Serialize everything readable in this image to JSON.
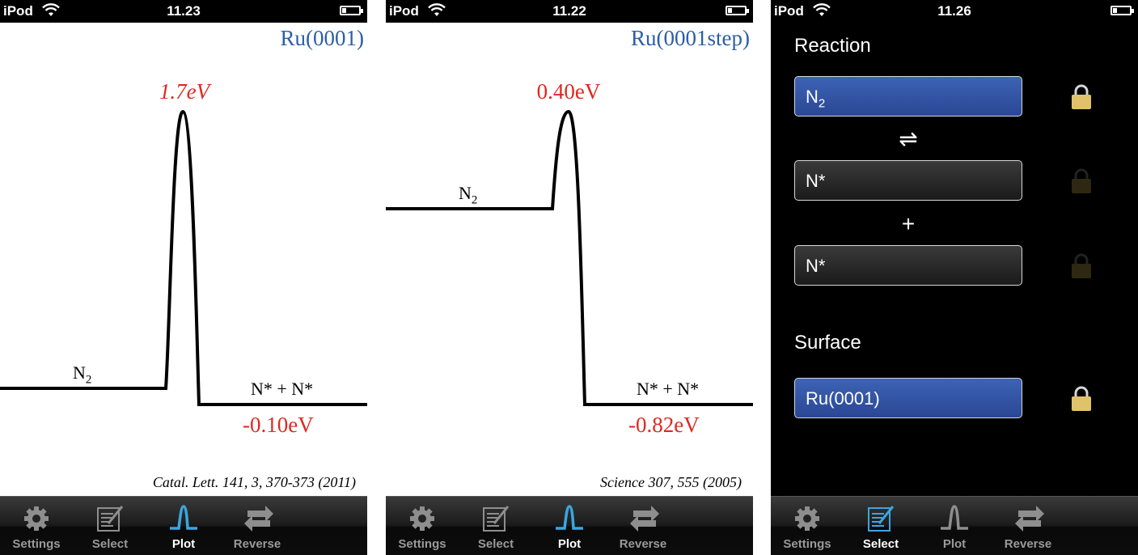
{
  "screens": [
    {
      "status": {
        "carrier": "iPod",
        "time": "11.23"
      },
      "plot": {
        "title": "Ru(0001)",
        "barrier_label": "1.7eV",
        "reactant_label": "N",
        "reactant_sub": "2",
        "product_label": "N* + N*",
        "reaction_energy": "-0.10eV",
        "reference": "Catal. Lett. 141, 3, 370-373 (2011)"
      }
    },
    {
      "status": {
        "carrier": "iPod",
        "time": "11.22"
      },
      "plot": {
        "title": "Ru(0001step)",
        "barrier_label": "0.40eV",
        "reactant_label": "N",
        "reactant_sub": "2",
        "product_label": "N* + N*",
        "reaction_energy": "-0.82eV",
        "reference": "Science 307, 555 (2005)"
      }
    },
    {
      "status": {
        "carrier": "iPod",
        "time": "11.26"
      },
      "reaction": {
        "heading": "Reaction",
        "reactant": "N",
        "reactant_sub": "2",
        "equilibrium_symbol": "⇌",
        "product1": "N*",
        "plus_symbol": "+",
        "product2": "N*"
      },
      "surface": {
        "heading": "Surface",
        "value": "Ru(0001)"
      }
    }
  ],
  "tabs": [
    "Settings",
    "Select",
    "Plot",
    "Reverse"
  ],
  "colors": {
    "title_blue": "#2b5ea8",
    "energy_red": "#e0281f",
    "tab_active_blue": "#3aa6e0",
    "field_blue": "#3d63b5",
    "lock_gold": "#e0c26a"
  },
  "icons": [
    "wifi-icon",
    "battery-icon",
    "gear-icon",
    "select-document-icon",
    "plot-peak-icon",
    "reverse-arrows-icon",
    "lock-icon"
  ]
}
